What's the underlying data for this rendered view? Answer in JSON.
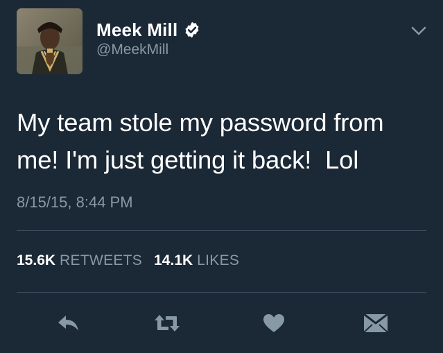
{
  "author": {
    "name": "Meek Mill",
    "handle": "@MeekMill",
    "verified": true
  },
  "tweet": {
    "text": "My team stole my password from\nme! I'm just getting it back!  Lol",
    "timestamp": "8/15/15, 8:44 PM"
  },
  "stats": {
    "retweets_count": "15.6K",
    "retweets_label": "RETWEETS",
    "likes_count": "14.1K",
    "likes_label": "LIKES"
  },
  "actions": {
    "reply_icon": "reply-icon",
    "retweet_icon": "retweet-icon",
    "like_icon": "heart-icon",
    "dm_icon": "envelope-icon"
  },
  "colors": {
    "background": "#1b2836",
    "primary_text": "#ffffff",
    "secondary_text": "#8899a6",
    "divider": "#3d4f61",
    "icon": "#8899a6"
  }
}
